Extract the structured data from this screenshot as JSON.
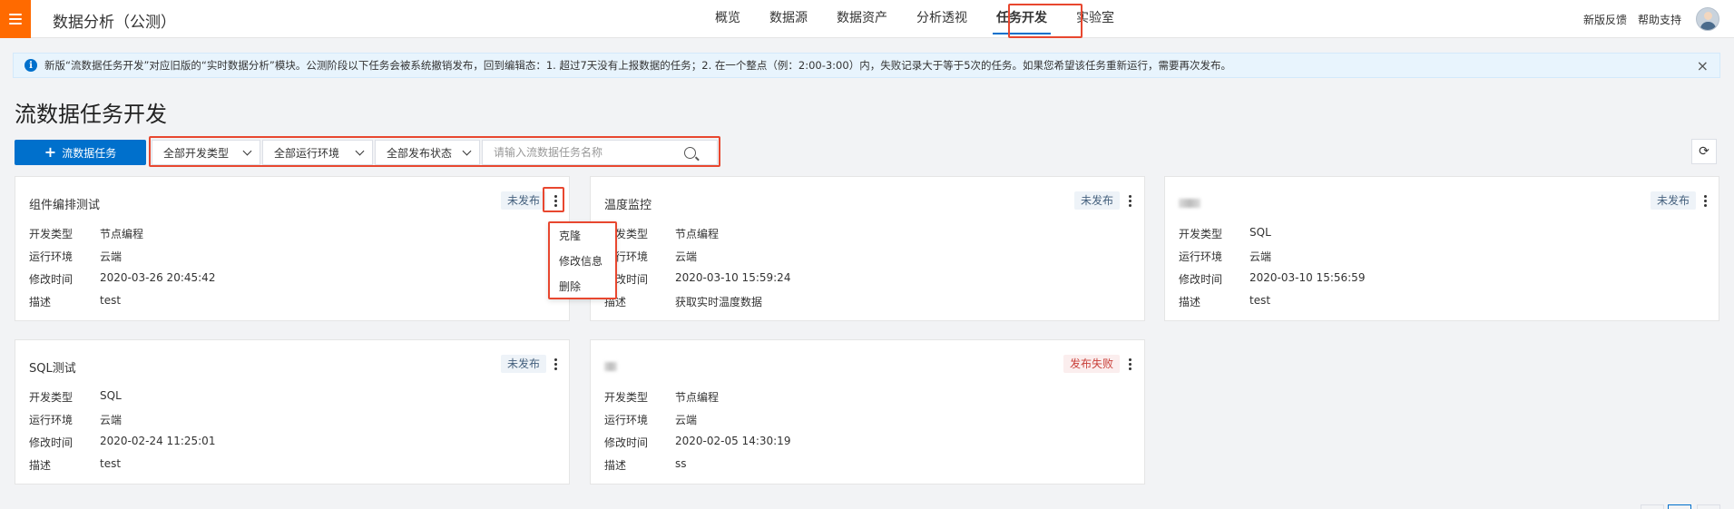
{
  "header": {
    "app_title": "数据分析（公测）",
    "nav": [
      "概览",
      "数据源",
      "数据资产",
      "分析透视",
      "任务开发",
      "实验室"
    ],
    "active_nav": "任务开发",
    "feedback": "新版反馈",
    "help": "帮助支持"
  },
  "notice": {
    "text": "新版“流数据任务开发”对应旧版的“实时数据分析”模块。公测阶段以下任务会被系统撤销发布，回到编辑态：1. 超过7天没有上报数据的任务；2. 在一个整点（例：2:00-3:00）内，失败记录大于等于5次的任务。如果您希望该任务重新运行，需要再次发布。",
    "info_icon_glyph": "i",
    "close_glyph": "×"
  },
  "page_title": "流数据任务开发",
  "toolbar": {
    "create_plus": "+",
    "create_label": "流数据任务",
    "filter_dev_type": "全部开发类型",
    "filter_env": "全部运行环境",
    "filter_status": "全部发布状态",
    "search_placeholder": "请输入流数据任务名称",
    "refresh_glyph": "⟳"
  },
  "field_labels": {
    "dev_type": "开发类型",
    "env": "运行环境",
    "modified": "修改时间",
    "desc": "描述"
  },
  "cards": [
    {
      "title": "组件编排测试",
      "status": "未发布",
      "dev_type": "节点编程",
      "env": "云端",
      "modified": "2020-03-26 20:45:42",
      "desc": "test"
    },
    {
      "title": "温度监控",
      "status": "未发布",
      "dev_type": "节点编程",
      "env": "云端",
      "modified": "2020-03-10 15:59:24",
      "desc": "获取实时温度数据"
    },
    {
      "title": "",
      "status": "未发布",
      "dev_type": "SQL",
      "env": "云端",
      "modified": "2020-03-10 15:56:59",
      "desc": "test"
    },
    {
      "title": "SQL测试",
      "status": "未发布",
      "dev_type": "SQL",
      "env": "云端",
      "modified": "2020-02-24 11:25:01",
      "desc": "test"
    },
    {
      "title": "",
      "status": "发布失败",
      "dev_type": "节点编程",
      "env": "云端",
      "modified": "2020-02-05 14:30:19",
      "desc": "ss"
    }
  ],
  "dropdown_menu": [
    "克隆",
    "修改信息",
    "删除"
  ],
  "colors": {
    "brand_orange": "#ff6a00",
    "primary_blue": "#0070cc",
    "highlight_red": "#e8472f"
  }
}
